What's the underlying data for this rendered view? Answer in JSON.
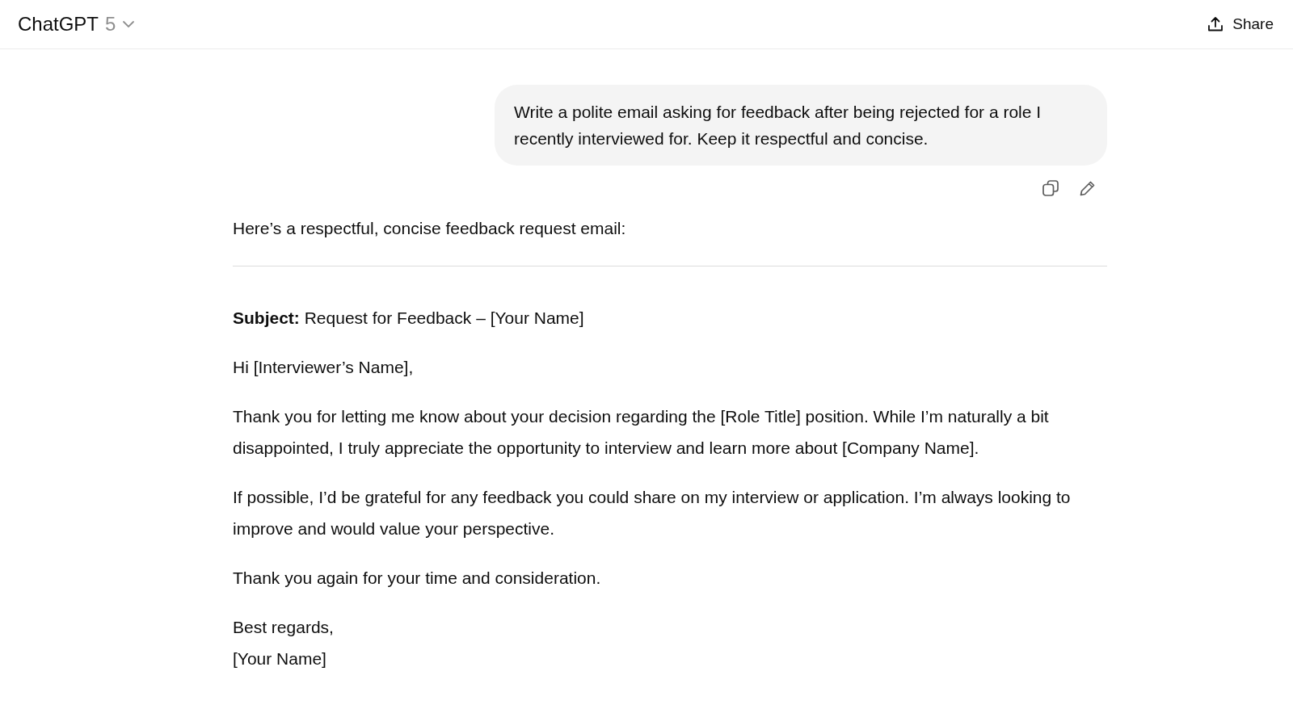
{
  "header": {
    "title": "ChatGPT",
    "model": "5",
    "share": "Share"
  },
  "user_message": "Write a polite email asking for feedback after being rejected for a role I recently interviewed for. Keep it respectful and concise.",
  "assistant": {
    "intro": "Here’s a respectful, concise feedback request email:",
    "subject": "**Subject:** Request for Feedback – [Your Name]",
    "paragraphs": [
      "Hi [Interviewer’s Name],",
      "Thank you for letting me know about your decision regarding the [Role Title] position. While I’m naturally a bit disappointed, I truly appreciate the opportunity to interview and learn more about [Company Name].",
      "If possible, I’d be grateful for any feedback you could share on my interview or application. I’m always looking to improve and would value your perspective.",
      "Thank you again for your time and consideration."
    ],
    "signoff": [
      "Best regards,",
      "[Your Name]"
    ]
  }
}
